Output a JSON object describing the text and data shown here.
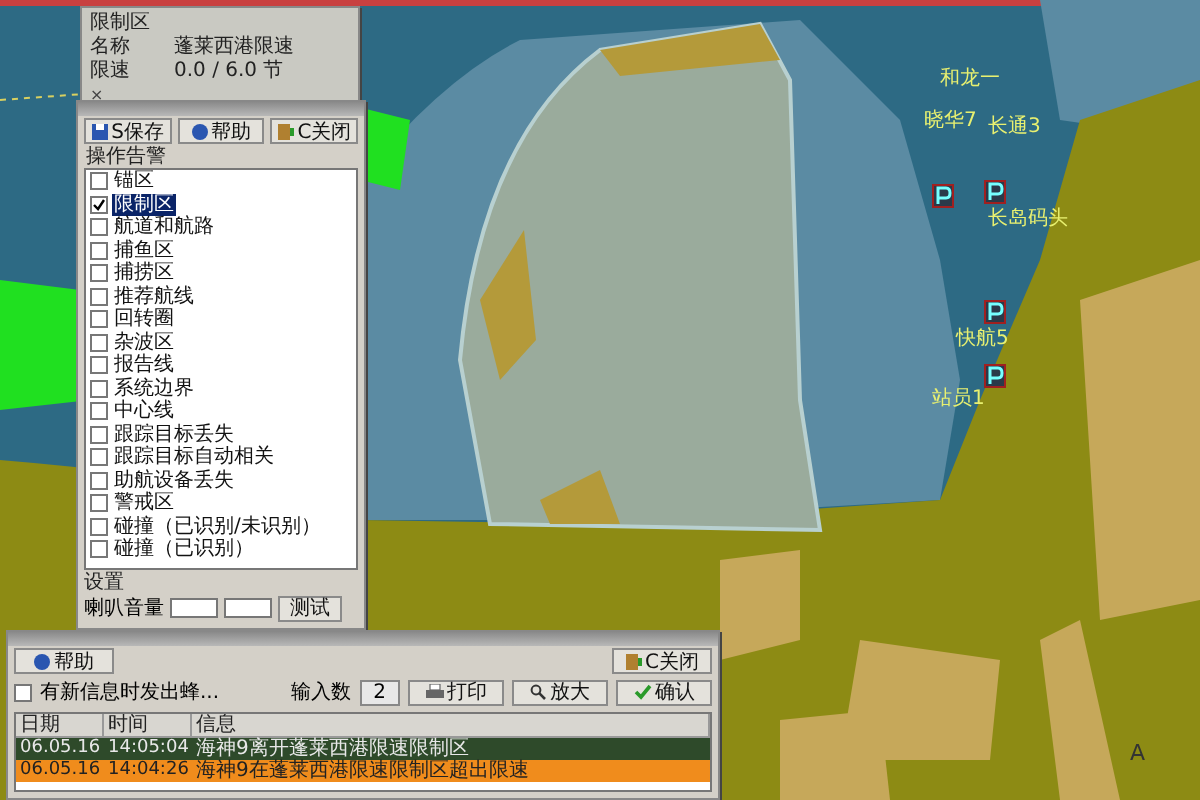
{
  "map": {
    "labels": [
      {
        "text": "和龙一"
      },
      {
        "text": "晓华7"
      },
      {
        "text": "长通3"
      },
      {
        "text": "长岛码头"
      },
      {
        "text": "快航5"
      },
      {
        "text": "站员1"
      }
    ],
    "corner_letter": "A"
  },
  "info_panel": {
    "title": "限制区",
    "fields": [
      {
        "label": "名称",
        "value": "蓬莱西港限速"
      },
      {
        "label": "限速",
        "value": "0.0 / 6.0 节"
      }
    ],
    "close": "×"
  },
  "alarm_panel": {
    "buttons": [
      {
        "label": "S保存",
        "kind": "save"
      },
      {
        "label": "帮助",
        "kind": "help"
      },
      {
        "label": "C关闭",
        "kind": "close"
      }
    ],
    "section": "操作告警",
    "items": [
      {
        "label": "锚区",
        "checked": false,
        "selected": false
      },
      {
        "label": "限制区",
        "checked": true,
        "selected": true
      },
      {
        "label": "航道和航路",
        "checked": false,
        "selected": false
      },
      {
        "label": "捕鱼区",
        "checked": false,
        "selected": false
      },
      {
        "label": "捕捞区",
        "checked": false,
        "selected": false
      },
      {
        "label": "推荐航线",
        "checked": false,
        "selected": false
      },
      {
        "label": "回转圈",
        "checked": false,
        "selected": false
      },
      {
        "label": "杂波区",
        "checked": false,
        "selected": false
      },
      {
        "label": "报告线",
        "checked": false,
        "selected": false
      },
      {
        "label": "系统边界",
        "checked": false,
        "selected": false
      },
      {
        "label": "中心线",
        "checked": false,
        "selected": false
      },
      {
        "label": "跟踪目标丢失",
        "checked": false,
        "selected": false
      },
      {
        "label": "跟踪目标自动相关",
        "checked": false,
        "selected": false
      },
      {
        "label": "助航设备丢失",
        "checked": false,
        "selected": false
      },
      {
        "label": "警戒区",
        "checked": false,
        "selected": false
      },
      {
        "label": "碰撞（已识别/未识别）",
        "checked": false,
        "selected": false
      },
      {
        "label": "碰撞（已识别）",
        "checked": false,
        "selected": false
      }
    ],
    "settings": {
      "title": "设置",
      "volume_label": "喇叭音量",
      "test_button": "测试"
    }
  },
  "log_panel": {
    "help_button": "帮助",
    "close_button": "C关闭",
    "notify": {
      "label": "有新信息时发出蜂...",
      "checked": false
    },
    "count_label": "输入数",
    "count": "2",
    "buttons": [
      {
        "label": "打印",
        "kind": "print"
      },
      {
        "label": "放大",
        "kind": "zoom"
      },
      {
        "label": "确认",
        "kind": "confirm"
      }
    ],
    "columns": [
      "日期",
      "时间",
      "信息"
    ],
    "rows": [
      {
        "date": "06.05.16",
        "time": "14:05:04",
        "message": "海神9离开蓬莱西港限速限制区",
        "color": "#2e4a2a"
      },
      {
        "date": "06.05.16",
        "time": "14:04:26",
        "message": "海神9在蓬莱西港限速限制区超出限速",
        "color": "#f08c1c"
      }
    ]
  }
}
